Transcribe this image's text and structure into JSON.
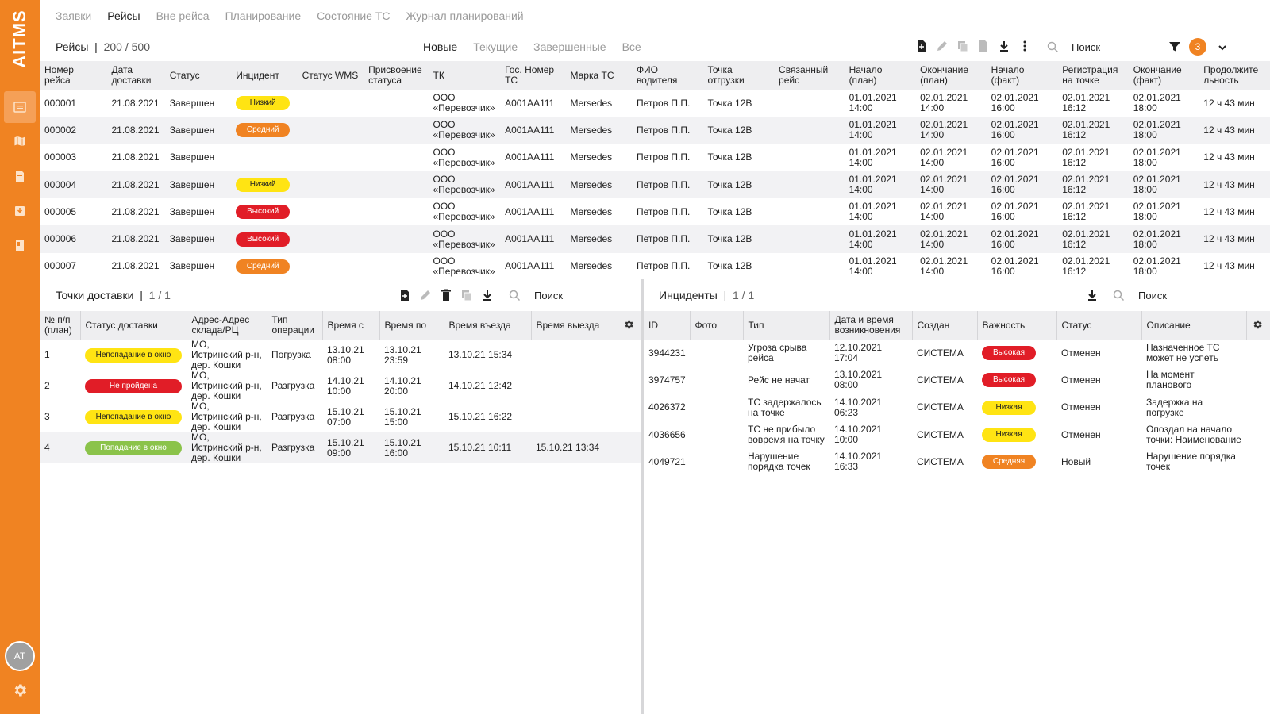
{
  "sidebar": {
    "logo": "AITMS",
    "avatar": "AT"
  },
  "topnav": [
    "Заявки",
    "Рейсы",
    "Вне рейса",
    "Планирование",
    "Состояние ТС",
    "Журнал планирований"
  ],
  "toolbar": {
    "title": "Рейсы",
    "count": "200 / 500",
    "filters": [
      "Новые",
      "Текущие",
      "Завершенные",
      "Все"
    ],
    "search": "Поиск",
    "filter_badge": "3"
  },
  "trips": {
    "headers": [
      "Номер рейса",
      "Дата доставки",
      "Статус",
      "Инцидент",
      "Статус WMS",
      "Присвоение статуса",
      "ТК",
      "Гос. Номер ТС",
      "Марка ТС",
      "ФИО водителя",
      "Точка отгрузки",
      "Связанный рейс",
      "Начало (план)",
      "Окончание (план)",
      "Начало (факт)",
      "Регистрация на точке",
      "Окончание (факт)",
      "Продолжите льность"
    ],
    "rows": [
      {
        "id": "000001",
        "date": "21.08.2021",
        "status": "Завершен",
        "incident": "Низкий",
        "wms": "",
        "assign": "",
        "tk": "ООО «Перевозчик»",
        "plate": "А001АА111",
        "brand": "Mersedes",
        "driver": "Петров П.П.",
        "point": "Точка 12В",
        "linked": "",
        "start_plan": "01.01.2021 14:00",
        "end_plan": "02.01.2021 14:00",
        "start_fact": "02.01.2021 16:00",
        "reg": "02.01.2021 16:12",
        "end_fact": "02.01.2021 18:00",
        "duration": "12 ч 43 мин"
      },
      {
        "id": "000002",
        "date": "21.08.2021",
        "status": "Завершен",
        "incident": "Средний",
        "wms": "",
        "assign": "",
        "tk": "ООО «Перевозчик»",
        "plate": "А001АА111",
        "brand": "Mersedes",
        "driver": "Петров П.П.",
        "point": "Точка 12В",
        "linked": "",
        "start_plan": "01.01.2021 14:00",
        "end_plan": "02.01.2021 14:00",
        "start_fact": "02.01.2021 16:00",
        "reg": "02.01.2021 16:12",
        "end_fact": "02.01.2021 18:00",
        "duration": "12 ч 43 мин"
      },
      {
        "id": "000003",
        "date": "21.08.2021",
        "status": "Завершен",
        "incident": "",
        "wms": "",
        "assign": "",
        "tk": "ООО «Перевозчик»",
        "plate": "А001АА111",
        "brand": "Mersedes",
        "driver": "Петров П.П.",
        "point": "Точка 12В",
        "linked": "",
        "start_plan": "01.01.2021 14:00",
        "end_plan": "02.01.2021 14:00",
        "start_fact": "02.01.2021 16:00",
        "reg": "02.01.2021 16:12",
        "end_fact": "02.01.2021 18:00",
        "duration": "12 ч 43 мин"
      },
      {
        "id": "000004",
        "date": "21.08.2021",
        "status": "Завершен",
        "incident": "Низкий",
        "wms": "",
        "assign": "",
        "tk": "ООО «Перевозчик»",
        "plate": "А001АА111",
        "brand": "Mersedes",
        "driver": "Петров П.П.",
        "point": "Точка 12В",
        "linked": "",
        "start_plan": "01.01.2021 14:00",
        "end_plan": "02.01.2021 14:00",
        "start_fact": "02.01.2021 16:00",
        "reg": "02.01.2021 16:12",
        "end_fact": "02.01.2021 18:00",
        "duration": "12 ч 43 мин"
      },
      {
        "id": "000005",
        "date": "21.08.2021",
        "status": "Завершен",
        "incident": "Высокий",
        "wms": "",
        "assign": "",
        "tk": "ООО «Перевозчик»",
        "plate": "А001АА111",
        "brand": "Mersedes",
        "driver": "Петров П.П.",
        "point": "Точка 12В",
        "linked": "",
        "start_plan": "01.01.2021 14:00",
        "end_plan": "02.01.2021 14:00",
        "start_fact": "02.01.2021 16:00",
        "reg": "02.01.2021 16:12",
        "end_fact": "02.01.2021 18:00",
        "duration": "12 ч 43 мин"
      },
      {
        "id": "000006",
        "date": "21.08.2021",
        "status": "Завершен",
        "incident": "Высокий",
        "wms": "",
        "assign": "",
        "tk": "ООО «Перевозчик»",
        "plate": "А001АА111",
        "brand": "Mersedes",
        "driver": "Петров П.П.",
        "point": "Точка 12В",
        "linked": "",
        "start_plan": "01.01.2021 14:00",
        "end_plan": "02.01.2021 14:00",
        "start_fact": "02.01.2021 16:00",
        "reg": "02.01.2021 16:12",
        "end_fact": "02.01.2021 18:00",
        "duration": "12 ч 43 мин"
      },
      {
        "id": "000007",
        "date": "21.08.2021",
        "status": "Завершен",
        "incident": "Средний",
        "wms": "",
        "assign": "",
        "tk": "ООО «Перевозчик»",
        "plate": "А001АА111",
        "brand": "Mersedes",
        "driver": "Петров П.П.",
        "point": "Точка 12В",
        "linked": "",
        "start_plan": "01.01.2021 14:00",
        "end_plan": "02.01.2021 14:00",
        "start_fact": "02.01.2021 16:00",
        "reg": "02.01.2021 16:12",
        "end_fact": "02.01.2021 18:00",
        "duration": "12 ч 43 мин"
      }
    ]
  },
  "points": {
    "title": "Точки доставки",
    "count": "1 / 1",
    "search": "Поиск",
    "headers": [
      "№ п/п (план)",
      "Статус доставки",
      "Адрес-Адрес склада/РЦ",
      "Тип операции",
      "Время с",
      "Время по",
      "Время въезда",
      "Время выезда"
    ],
    "rows": [
      {
        "n": "1",
        "status": "Непопадание в окно",
        "status_color": "yellow",
        "addr": "МО, Истринский р-н, дер. Кошки",
        "op": "Погрузка",
        "from": "13.10.21 08:00",
        "to": "13.10.21 23:59",
        "in": "13.10.21 15:34",
        "out": ""
      },
      {
        "n": "2",
        "status": "Не пройдена",
        "status_color": "red",
        "addr": "МО, Истринский р-н, дер. Кошки",
        "op": "Разгрузка",
        "from": "14.10.21 10:00",
        "to": "14.10.21 20:00",
        "in": "14.10.21 12:42",
        "out": ""
      },
      {
        "n": "3",
        "status": "Непопадание в окно",
        "status_color": "yellow",
        "addr": "МО, Истринский р-н, дер. Кошки",
        "op": "Разгрузка",
        "from": "15.10.21 07:00",
        "to": "15.10.21 15:00",
        "in": "15.10.21 16:22",
        "out": ""
      },
      {
        "n": "4",
        "status": "Попадание в окно",
        "status_color": "green",
        "addr": "МО, Истринский р-н, дер. Кошки",
        "op": "Разгрузка",
        "from": "15.10.21 09:00",
        "to": "15.10.21 16:00",
        "in": "15.10.21 10:11",
        "out": "15.10.21 13:34"
      }
    ]
  },
  "incidents": {
    "title": "Инциденты",
    "count": "1 / 1",
    "search": "Поиск",
    "headers": [
      "ID",
      "Фото",
      "Тип",
      "Дата и время возникновения",
      "Создан",
      "Важность",
      "Статус",
      "Описание"
    ],
    "rows": [
      {
        "id": "3944231",
        "photo": "",
        "type": "Угроза срыва рейса",
        "dt": "12.10.2021 17:04",
        "created": "СИСТЕМА",
        "sev": "Высокая",
        "sev_color": "red",
        "status": "Отменен",
        "desc": "Назначенное ТС может не успеть"
      },
      {
        "id": "3974757",
        "photo": "",
        "type": "Рейс не начат",
        "dt": "13.10.2021 08:00",
        "created": "СИСТЕМА",
        "sev": "Высокая",
        "sev_color": "red",
        "status": "Отменен",
        "desc": "На момент планового"
      },
      {
        "id": "4026372",
        "photo": "",
        "type": "ТС задержалось на точке",
        "dt": "14.10.2021 06:23",
        "created": "СИСТЕМА",
        "sev": "Низкая",
        "sev_color": "yellow",
        "status": "Отменен",
        "desc": "Задержка на погрузке"
      },
      {
        "id": "4036656",
        "photo": "",
        "type": "ТС не прибыло вовремя на точку",
        "dt": "14.10.2021 10:00",
        "created": "СИСТЕМА",
        "sev": "Низкая",
        "sev_color": "yellow",
        "status": "Отменен",
        "desc": "Опоздал на начало точки: Наименование"
      },
      {
        "id": "4049721",
        "photo": "",
        "type": "Нарушение порядка точек",
        "dt": "14.10.2021 16:33",
        "created": "СИСТЕМА",
        "sev": "Средняя",
        "sev_color": "orange",
        "status": "Новый",
        "desc": "Нарушение порядка точек"
      }
    ]
  },
  "colors": {
    "accent": "#f08322",
    "yellow": "#ffe413",
    "red": "#e11d27",
    "green": "#8bc34a",
    "header_bg": "#eeeef0"
  }
}
